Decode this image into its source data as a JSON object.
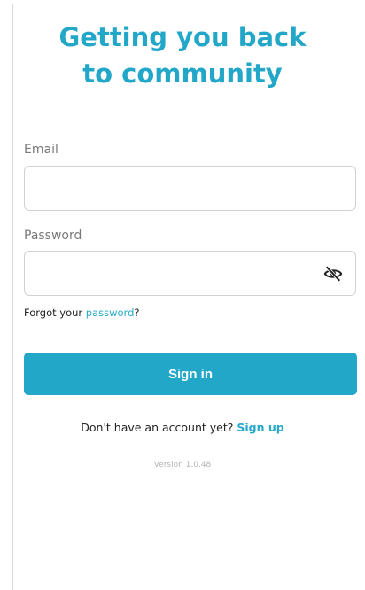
{
  "header": {
    "title_line1": "Getting you back",
    "title_line2": "to community"
  },
  "form": {
    "email_label": "Email",
    "email_value": "",
    "password_label": "Password",
    "password_value": "",
    "forgot_prefix": "Forgot your ",
    "forgot_link": "password",
    "forgot_suffix": "?",
    "signin_label": "Sign in",
    "password_toggle_icon": "eye-off-icon"
  },
  "footer": {
    "no_account_text": "Don't have an account yet?",
    "signup_link": "Sign up",
    "version": "Version 1.0.48"
  },
  "colors": {
    "accent": "#22a7c9",
    "background": "#ffffff"
  }
}
